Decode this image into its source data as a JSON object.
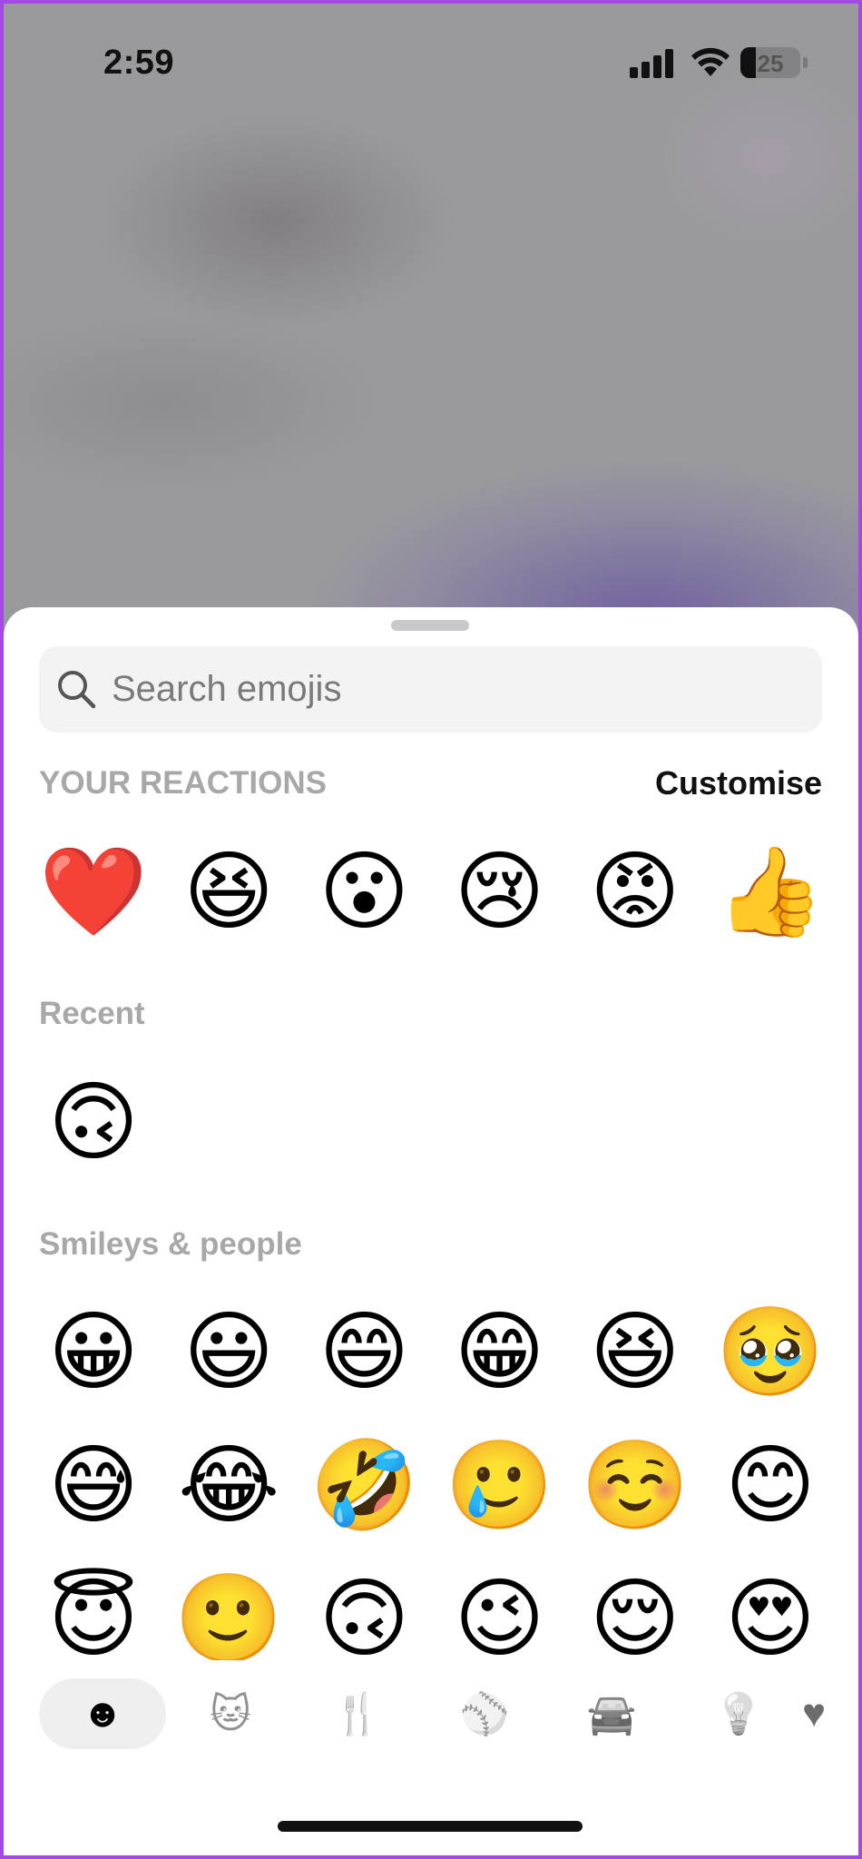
{
  "status_bar": {
    "time": "2:59",
    "battery": "25",
    "battery_level": 0.25
  },
  "search": {
    "placeholder": "Search emojis"
  },
  "reactions": {
    "title": "YOUR REACTIONS",
    "customise_label": "Customise",
    "items": [
      "❤️",
      "😆",
      "😮",
      "😢",
      "😡",
      "👍"
    ]
  },
  "recent": {
    "title": "Recent",
    "items": [
      "🙃"
    ]
  },
  "smileys": {
    "title": "Smileys & people",
    "rows": [
      [
        "😀",
        "😃",
        "😄",
        "😁",
        "😆",
        "🥹"
      ],
      [
        "😅",
        "😂",
        "🤣",
        "🥲",
        "☺️",
        "😊"
      ],
      [
        "😇",
        "🙂",
        "🙃",
        "😉",
        "😌",
        "😍"
      ]
    ]
  },
  "tabs": [
    {
      "icon": "smiley-icon",
      "glyph": "☻",
      "active": true
    },
    {
      "icon": "animal-icon",
      "glyph": "🐱",
      "active": false
    },
    {
      "icon": "food-icon",
      "glyph": "🍴",
      "active": false
    },
    {
      "icon": "activity-icon",
      "glyph": "⚾",
      "active": false
    },
    {
      "icon": "travel-icon",
      "glyph": "🚘",
      "active": false
    },
    {
      "icon": "objects-icon",
      "glyph": "💡",
      "active": false
    },
    {
      "icon": "symbols-icon",
      "glyph": "♥",
      "active": false
    }
  ],
  "colors": {
    "sheet_bg": "#ffffff",
    "search_bg": "#f2f3f2",
    "section_title": "#a8a8a8",
    "frame": "#a349e6"
  }
}
